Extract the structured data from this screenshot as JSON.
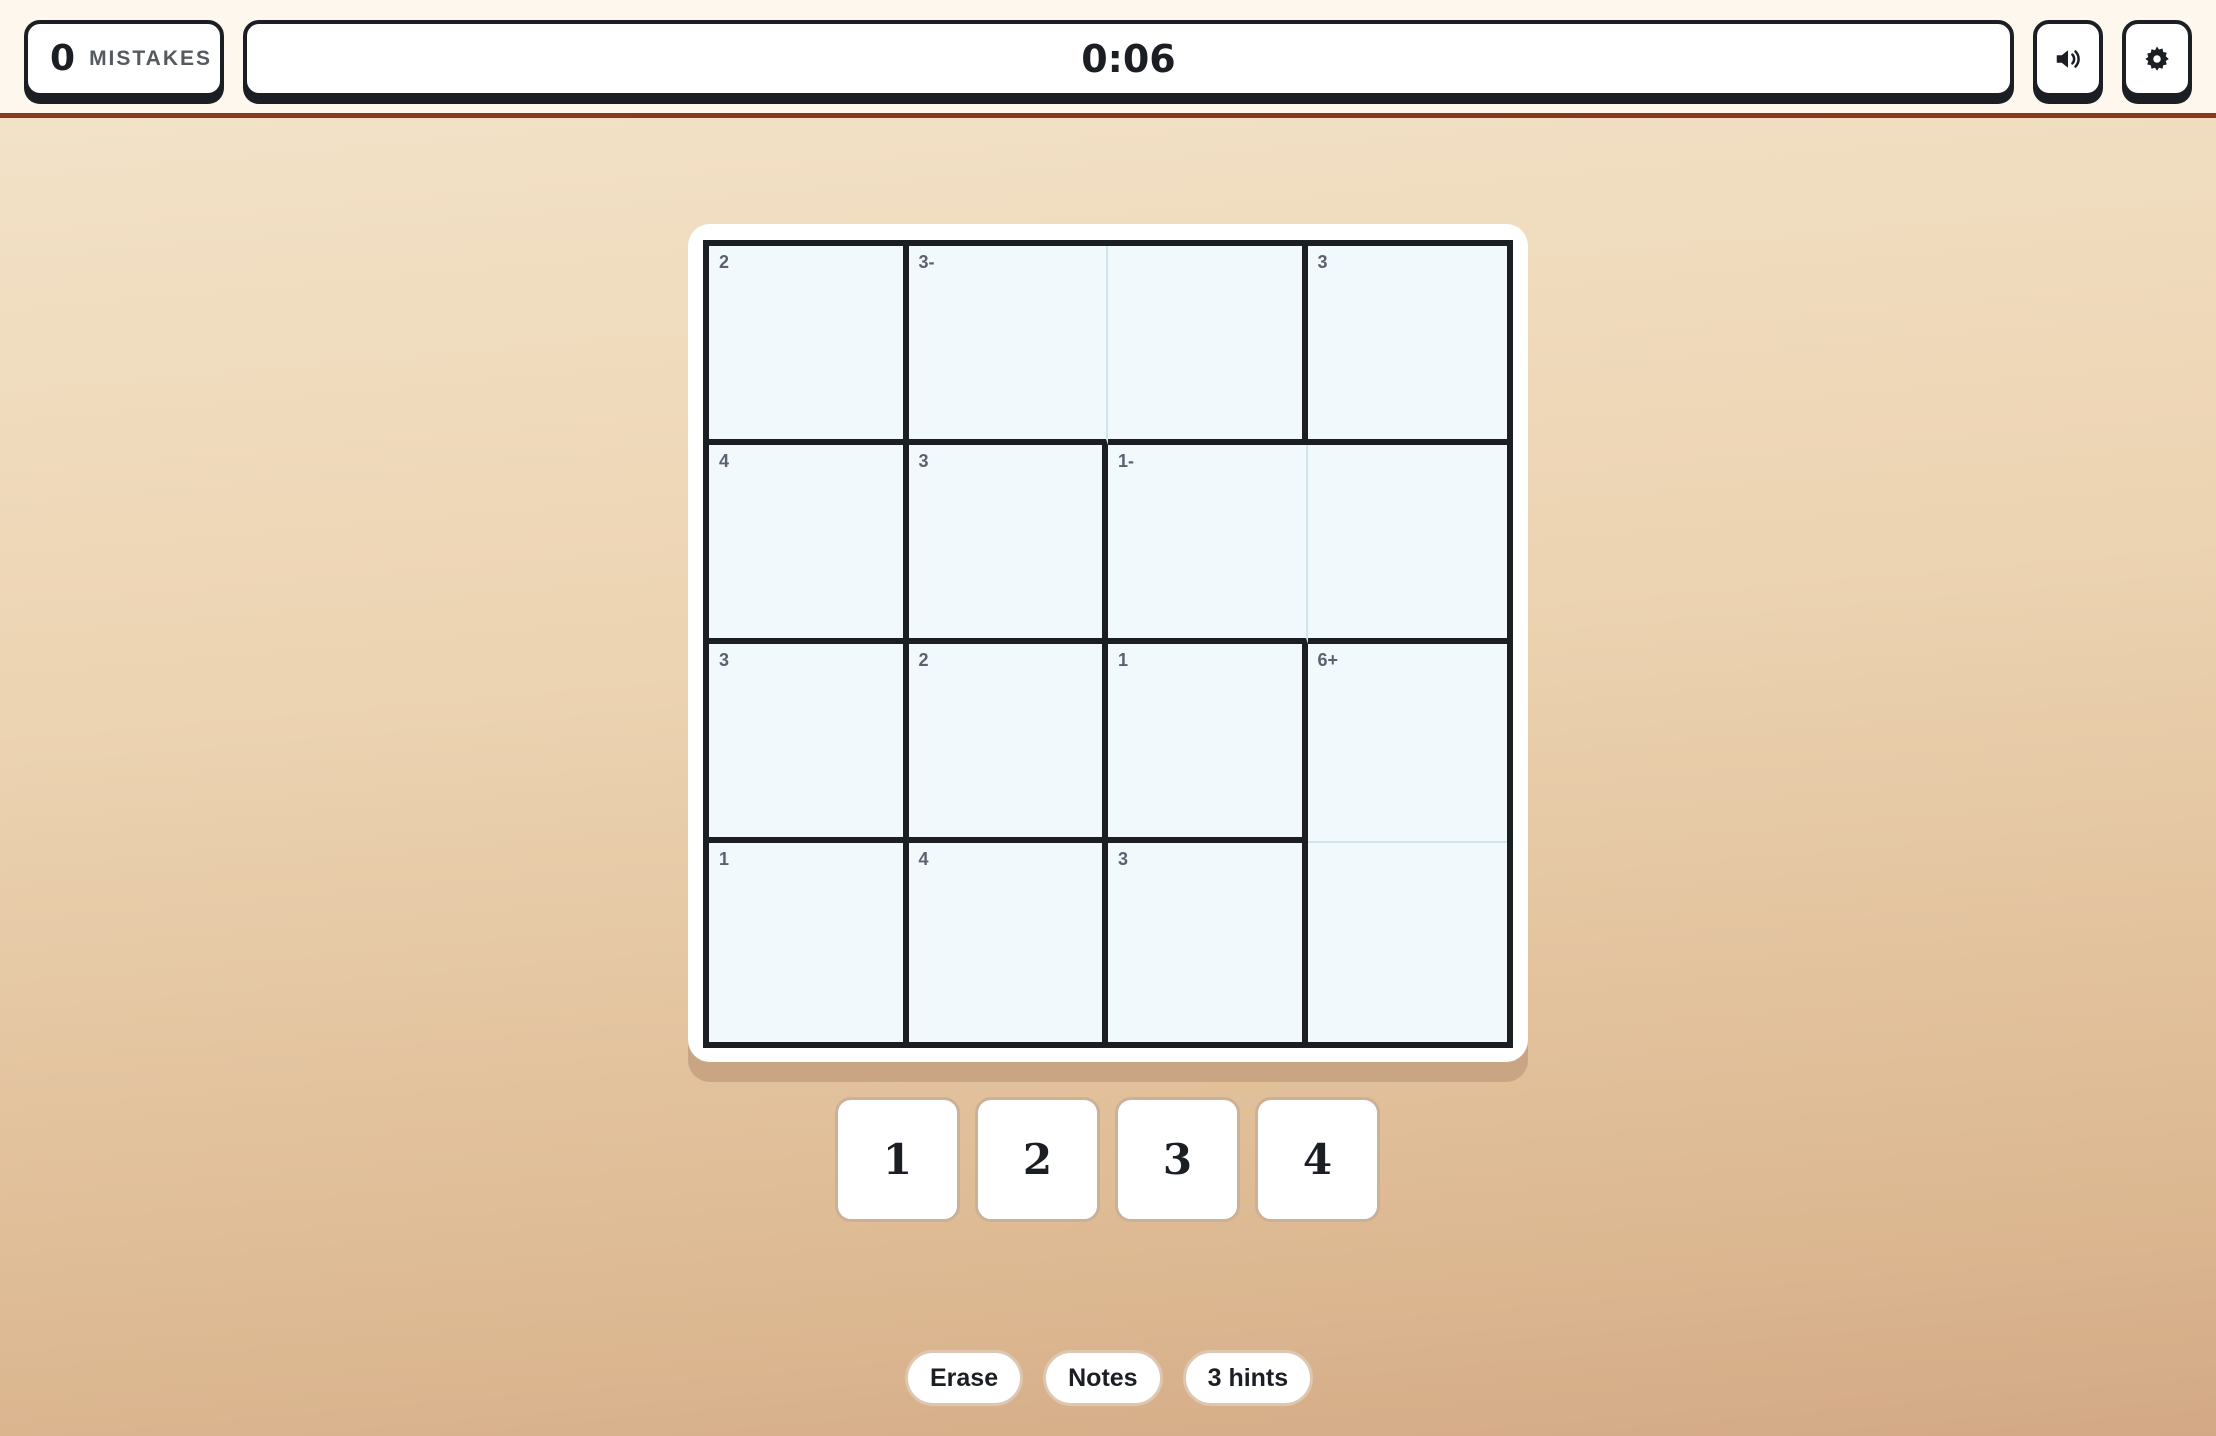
{
  "header": {
    "mistakes_count": "0",
    "mistakes_label": "MISTAKES",
    "timer": "0:06",
    "sound_icon": "speaker-icon",
    "settings_icon": "gear-icon"
  },
  "board": {
    "size": 4,
    "cells": [
      {
        "clue": "2"
      },
      {
        "clue": "3-"
      },
      {
        "clue": ""
      },
      {
        "clue": "3"
      },
      {
        "clue": "4"
      },
      {
        "clue": "3"
      },
      {
        "clue": "1-"
      },
      {
        "clue": ""
      },
      {
        "clue": "3"
      },
      {
        "clue": "2"
      },
      {
        "clue": "1"
      },
      {
        "clue": "6+"
      },
      {
        "clue": "1"
      },
      {
        "clue": "4"
      },
      {
        "clue": "3"
      },
      {
        "clue": ""
      }
    ]
  },
  "numpad": {
    "keys": [
      "1",
      "2",
      "3",
      "4"
    ]
  },
  "actions": {
    "erase": "Erase",
    "notes": "Notes",
    "hints": "3 hints"
  },
  "colors": {
    "accent_line": "#8a3a1c",
    "grid_fill": "#f1f9fd",
    "ink": "#1b1f24"
  }
}
